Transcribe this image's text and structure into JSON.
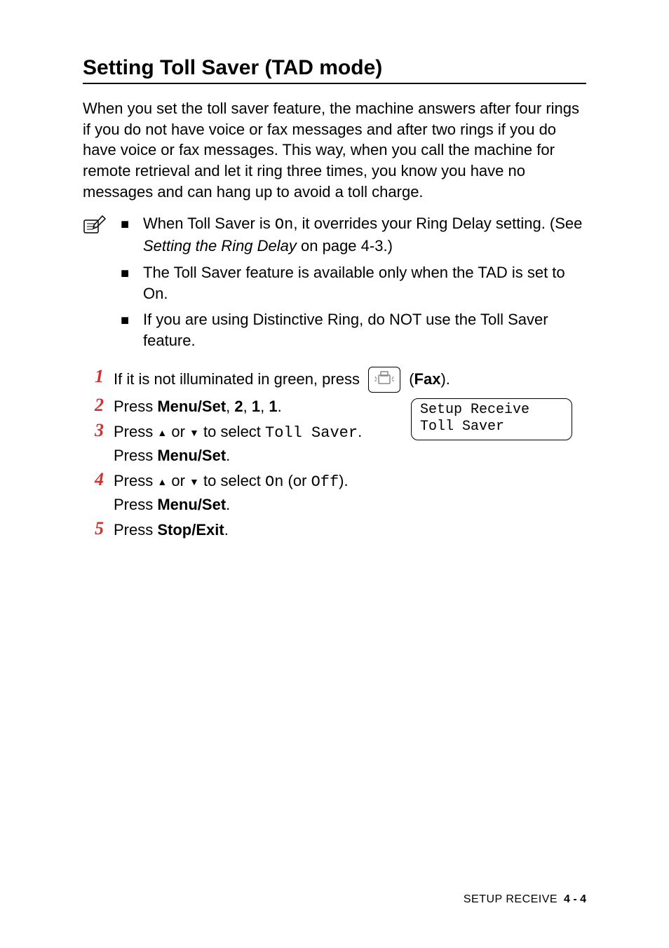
{
  "heading": "Setting Toll Saver (TAD mode)",
  "intro": "When you set the toll saver feature, the machine answers after four rings if you do not have voice or fax messages and after two rings if you do have voice or fax messages. This way, when you call the machine for remote retrieval and let it ring three times, you know you have no messages and can hang up to avoid a toll charge.",
  "notes": {
    "items": [
      {
        "pre": "When Toll Saver is ",
        "code1": "On",
        "mid": ", it overrides your Ring Delay setting. (See ",
        "italic": "Setting the Ring Delay",
        "post": " on page 4-3.)"
      },
      {
        "text": "The Toll Saver feature is available only when the TAD is set to On."
      },
      {
        "text": "If you are using Distinctive Ring, do NOT use the Toll Saver feature."
      }
    ]
  },
  "steps": [
    {
      "num": "1",
      "pre": "If it is not illuminated in green, press ",
      "post_open": " (",
      "bold": "Fax",
      "post_close": ")."
    },
    {
      "num": "2",
      "pre": "Press ",
      "bold1": "Menu/Set",
      "sep1": ", ",
      "bold2": "2",
      "sep2": ", ",
      "bold3": "1",
      "sep3": ", ",
      "bold4": "1",
      "post": "."
    },
    {
      "num": "3",
      "line1_pre": "Press ",
      "line1_mid": " or ",
      "line1_post1": " to select ",
      "line1_code": "Toll Saver",
      "line1_end": ".",
      "line2_pre": "Press ",
      "line2_bold": "Menu/Set",
      "line2_post": "."
    },
    {
      "num": "4",
      "line1_pre": "Press ",
      "line1_mid": " or ",
      "line1_post1": " to select ",
      "line1_code1": "On",
      "line1_paren1": " (or ",
      "line1_code2": "Off",
      "line1_paren2": ").",
      "line2_pre": "Press ",
      "line2_bold": "Menu/Set",
      "line2_post": "."
    },
    {
      "num": "5",
      "pre": "Press ",
      "bold": "Stop/Exit",
      "post": "."
    }
  ],
  "lcd": {
    "line1": "Setup Receive",
    "line2": "Toll Saver"
  },
  "footer": {
    "label": "SETUP RECEIVE",
    "page": "4 - 4"
  },
  "icons": {
    "note": "note-pencil-icon",
    "fax": "fax-icon"
  }
}
